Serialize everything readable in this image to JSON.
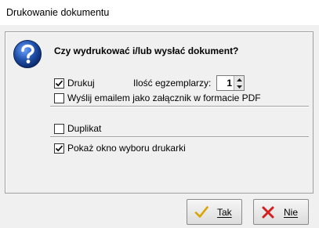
{
  "window": {
    "title": "Drukowanie dokumentu"
  },
  "dialog": {
    "question": "Czy wydrukować i/lub wysłać dokument?",
    "options": {
      "print": {
        "label": "Drukuj",
        "checked": true
      },
      "copies_label": "Ilość egzemplarzy:",
      "copies_value": "1",
      "email": {
        "label": "Wyślij emailem jako załącznik w formacie PDF",
        "checked": false
      },
      "duplicate": {
        "label": "Duplikat",
        "checked": false
      },
      "printer_dialog": {
        "label": "Pokaż okno wyboru drukarki",
        "checked": true
      }
    }
  },
  "buttons": {
    "yes": {
      "label": "Tak",
      "icon": "checkmark-icon"
    },
    "no": {
      "label": "Nie",
      "icon": "x-icon"
    }
  },
  "colors": {
    "question_icon": "#1f4fa8",
    "yes_icon": "#d9a400",
    "no_icon": "#d21f1f"
  }
}
